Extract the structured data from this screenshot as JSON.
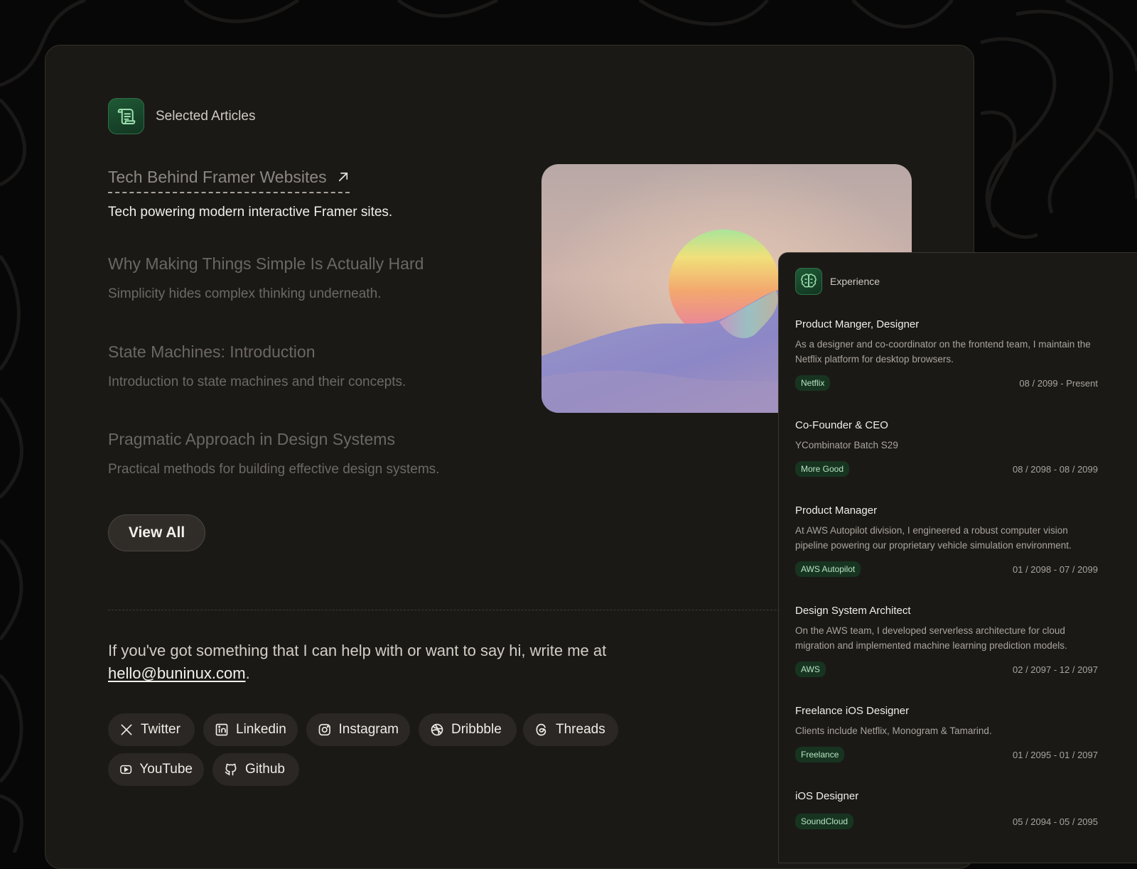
{
  "articles_section": {
    "title": "Selected Articles",
    "icon": "scroll-icon",
    "items": [
      {
        "title": "Tech Behind Framer Websites",
        "desc": "Tech powering modern interactive Framer sites."
      },
      {
        "title": "Why Making Things Simple Is Actually Hard",
        "desc": "Simplicity hides complex thinking underneath."
      },
      {
        "title": "State Machines: Introduction",
        "desc": "Introduction to state machines and their concepts."
      },
      {
        "title": "Pragmatic Approach in Design Systems",
        "desc": "Practical methods for building effective design systems."
      }
    ],
    "view_all_label": "View All"
  },
  "contact": {
    "text_before": "If you've got something that I can help with or want to say hi, write me at",
    "email": "hello@buninux.com",
    "text_after": "."
  },
  "socials": [
    {
      "label": "Twitter",
      "icon": "x-icon"
    },
    {
      "label": "Linkedin",
      "icon": "linkedin-icon"
    },
    {
      "label": "Instagram",
      "icon": "instagram-icon"
    },
    {
      "label": "Dribbble",
      "icon": "dribbble-icon"
    },
    {
      "label": "Threads",
      "icon": "threads-icon"
    },
    {
      "label": "YouTube",
      "icon": "youtube-icon"
    },
    {
      "label": "Github",
      "icon": "github-icon"
    }
  ],
  "experience": {
    "title": "Experience",
    "icon": "brain-icon",
    "jobs": [
      {
        "title": "Product Manger, Designer",
        "desc": "As a designer and co-coordinator on the frontend team, I maintain the Netflix platform for desktop browsers.",
        "company": "Netflix",
        "dates": "08 / 2099 - Present"
      },
      {
        "title": "Co-Founder & CEO",
        "desc": "YCombinator Batch S29",
        "company": "More Good",
        "dates": "08 / 2098 - 08 / 2099"
      },
      {
        "title": "Product Manager",
        "desc": "At AWS Autopilot division, I engineered a robust computer vision pipeline powering our proprietary vehicle simulation environment.",
        "company": "AWS Autopilot",
        "dates": "01 / 2098 - 07 / 2099"
      },
      {
        "title": "Design System Architect",
        "desc": "On the AWS team, I developed serverless architecture for cloud migration and implemented machine learning prediction models.",
        "company": "AWS",
        "dates": "02 / 2097 - 12 / 2097"
      },
      {
        "title": "Freelance iOS Designer",
        "desc": "Clients include Netflix, Monogram & Tamarind.",
        "company": "Freelance",
        "dates": "01 / 2095 - 01 / 2097"
      },
      {
        "title": "iOS Designer",
        "desc": "",
        "company": "SoundCloud",
        "dates": "05 / 2094 - 05 / 2095"
      }
    ]
  },
  "colors": {
    "accent_green": "#2e7046",
    "background": "#070707",
    "card": "#1b1916"
  }
}
